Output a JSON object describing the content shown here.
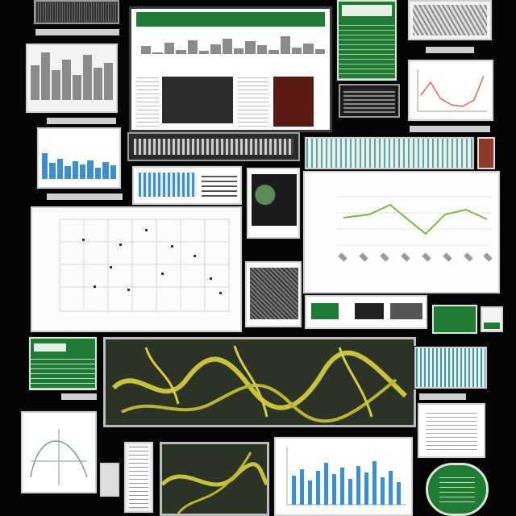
{
  "colors": {
    "background": "#050505",
    "panel": "#f3f4f2",
    "green": "#1f7a34",
    "blue_bar": "#3c8fd1",
    "line_green": "#7ab648",
    "line_red": "#d96a50",
    "map_dark": "#2a3326",
    "map_yellow": "#c8c338",
    "dark_red": "#5a1a14"
  },
  "icons": {
    "green_badge": "rounded-green-badge",
    "thumbnail": "small-thumbnail"
  }
}
